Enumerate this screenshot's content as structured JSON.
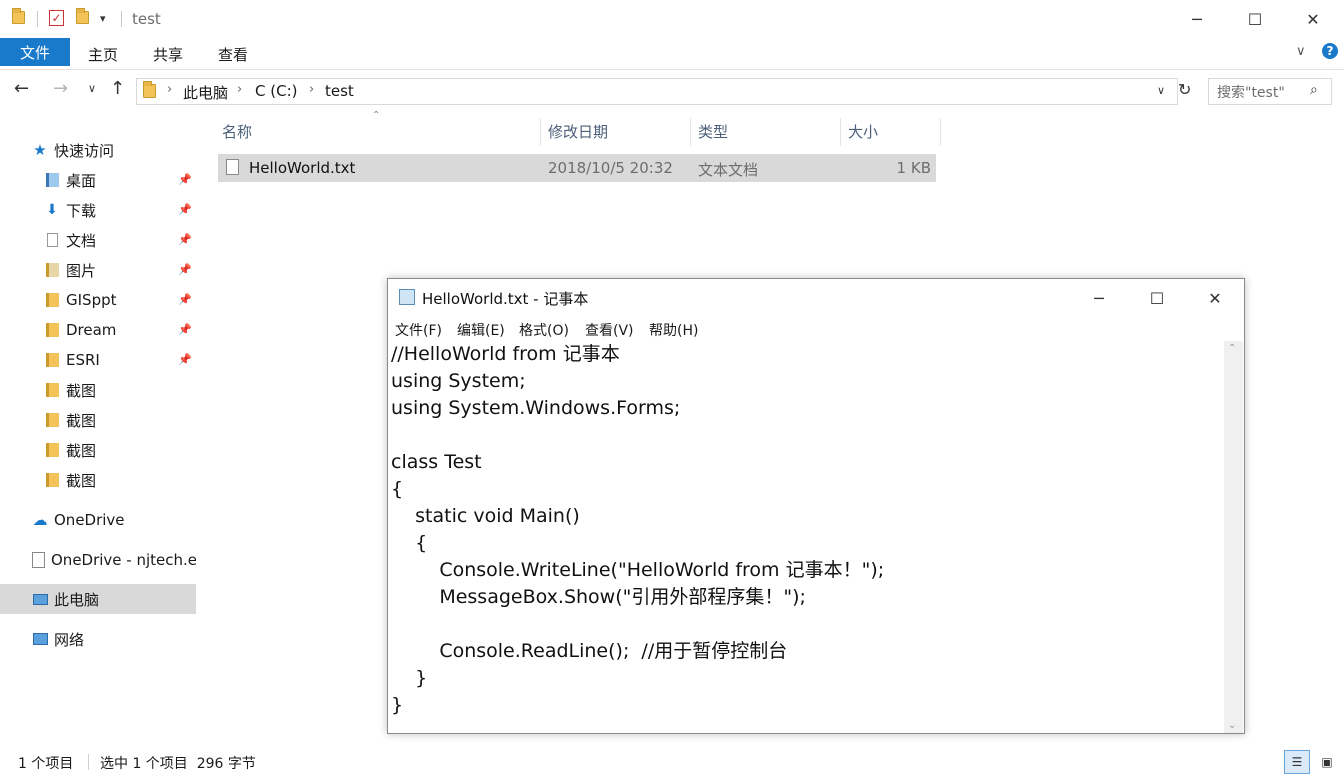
{
  "window": {
    "title": "test",
    "minimize": "─",
    "maximize": "☐",
    "close": "✕"
  },
  "ribbon": {
    "tabs": [
      "文件",
      "主页",
      "共享",
      "查看"
    ]
  },
  "address": {
    "path": [
      "此电脑",
      "C (C:)",
      "test"
    ],
    "search_placeholder": "搜索\"test\""
  },
  "sidebar": {
    "quick_access": "快速访问",
    "items": [
      {
        "label": "桌面",
        "pinned": true,
        "icon": "desktop-folder-icon"
      },
      {
        "label": "下载",
        "pinned": true,
        "icon": "download-folder-icon"
      },
      {
        "label": "文档",
        "pinned": true,
        "icon": "documents-folder-icon"
      },
      {
        "label": "图片",
        "pinned": true,
        "icon": "pictures-folder-icon"
      },
      {
        "label": "GISppt",
        "pinned": true,
        "icon": "folder-icon"
      },
      {
        "label": "Dream",
        "pinned": true,
        "icon": "folder-icon"
      },
      {
        "label": "ESRI",
        "pinned": true,
        "icon": "folder-icon"
      },
      {
        "label": "截图",
        "pinned": false,
        "icon": "folder-icon"
      },
      {
        "label": "截图",
        "pinned": false,
        "icon": "folder-icon"
      },
      {
        "label": "截图",
        "pinned": false,
        "icon": "folder-icon"
      },
      {
        "label": "截图",
        "pinned": false,
        "icon": "folder-icon"
      }
    ],
    "onedrive": "OneDrive",
    "onedrive_org": "OneDrive - njtech.e",
    "this_pc": "此电脑",
    "network": "网络"
  },
  "file_list": {
    "columns": [
      "名称",
      "修改日期",
      "类型",
      "大小"
    ],
    "rows": [
      {
        "name": "HelloWorld.txt",
        "modified": "2018/10/5 20:32",
        "type": "文本文档",
        "size": "1 KB"
      }
    ]
  },
  "notepad": {
    "title": "HelloWorld.txt - 记事本",
    "menu": [
      "文件(F)",
      "编辑(E)",
      "格式(O)",
      "查看(V)",
      "帮助(H)"
    ],
    "lines": [
      "//HelloWorld from 记事本",
      "using System;",
      "using System.Windows.Forms;",
      "",
      "class Test",
      "{",
      "    static void Main()",
      "    {",
      "        Console.WriteLine(\"HelloWorld from 记事本！\");",
      "        MessageBox.Show(\"引用外部程序集！\");",
      "",
      "        Console.ReadLine();  //用于暂停控制台",
      "    }",
      "}"
    ]
  },
  "status": {
    "count": "1 个项目",
    "selection": "选中 1 个项目  296 字节"
  },
  "colors": {
    "accent": "#1979ca",
    "selected_row": "#d9d9d9",
    "sidebar_selected": "#d9d9d9",
    "header_text": "#4c607a"
  }
}
